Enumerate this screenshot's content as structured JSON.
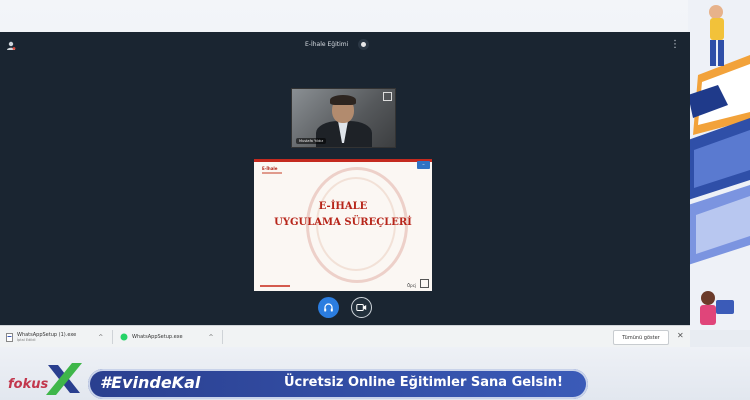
{
  "meeting": {
    "title": "E-İhale Eğitimi",
    "participant_name": "Mustafa Yıldız"
  },
  "slide": {
    "logo": "E-İhale",
    "line1": "E-İHALE",
    "line2": "UYGULAMA SÜREÇLERİ",
    "brand": "Öpcj"
  },
  "downloads": {
    "items": [
      {
        "name": "WhatsAppSetup (1).exe",
        "status": "İptal Edildi"
      },
      {
        "name": "WhatsAppSetup.exe",
        "status": ""
      }
    ],
    "show_all_label": "Tümünü göster"
  },
  "banner": {
    "brand": "fokus",
    "hashtag": "#EvindeKal",
    "slogan": "Ücretsiz Online Eğitimler Sana Gelsin!"
  },
  "colors": {
    "meeting_bg": "#1a2531",
    "audio_button": "#2b7de0",
    "slide_red": "#b7251a",
    "banner_blue": "#2a3f8f",
    "brand_pink": "#c2374d"
  },
  "icons": [
    "user-icon",
    "record-icon",
    "more-vert-icon",
    "headphones-icon",
    "camera-icon",
    "expand-icon",
    "file-icon",
    "chevron-up-icon",
    "close-icon"
  ]
}
